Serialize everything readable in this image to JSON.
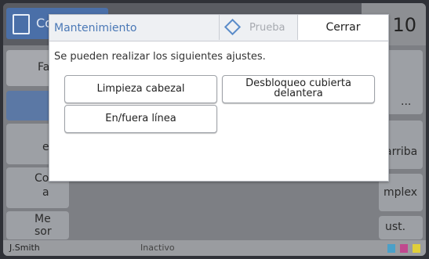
{
  "background": {
    "app_button_label": "Co",
    "counter_value": "10",
    "left_items": [
      "Fa",
      "ej",
      "Cor",
      "a",
      "Me",
      "sor"
    ],
    "right_items": [
      "...",
      "arriba",
      "mplex",
      "ust."
    ],
    "status": {
      "user": "J.Smith",
      "state": "Inactivo",
      "ink_labels": [
        "C",
        "M",
        "Y"
      ]
    }
  },
  "dialog": {
    "title": "Mantenimiento",
    "test_button_label": "Prueba",
    "close_button_label": "Cerrar",
    "message": "Se pueden realizar los siguientes ajustes.",
    "options": [
      {
        "label": "Limpieza cabezal"
      },
      {
        "label": "Desbloqueo cubierta delantera"
      },
      {
        "label": "En/fuera línea"
      }
    ]
  },
  "colors": {
    "accent": "#4a78b6",
    "dim_overlay": "#7d7f84"
  }
}
